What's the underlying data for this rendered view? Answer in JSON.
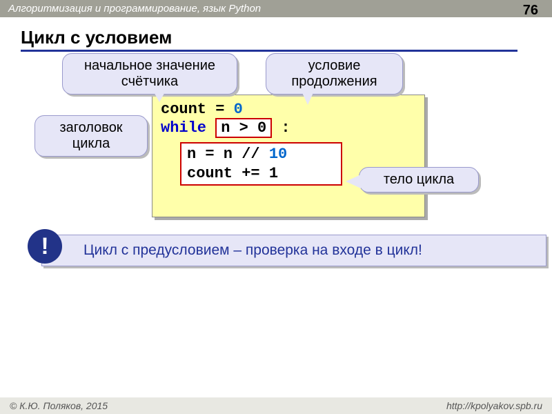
{
  "header": {
    "course": "Алгоритмизация и программирование, язык Python",
    "page": "76"
  },
  "title": "Цикл с условием",
  "callouts": {
    "init": "начальное значение счётчика",
    "cond": "условие продолжения",
    "head": "заголовок цикла",
    "body": "тело цикла"
  },
  "code": {
    "assign_lhs": "count = ",
    "assign_rhs": "0",
    "while_kw": "while",
    "cond": "n > 0",
    "colon": " :",
    "body1": "n = n // ",
    "body1_num": "10",
    "body2": "count += 1"
  },
  "note": {
    "bang": "!",
    "text": "Цикл с предусловием – проверка на входе в цикл!"
  },
  "footer": {
    "left": "© К.Ю. Поляков, 2015",
    "right": "http://kpolyakov.spb.ru"
  }
}
